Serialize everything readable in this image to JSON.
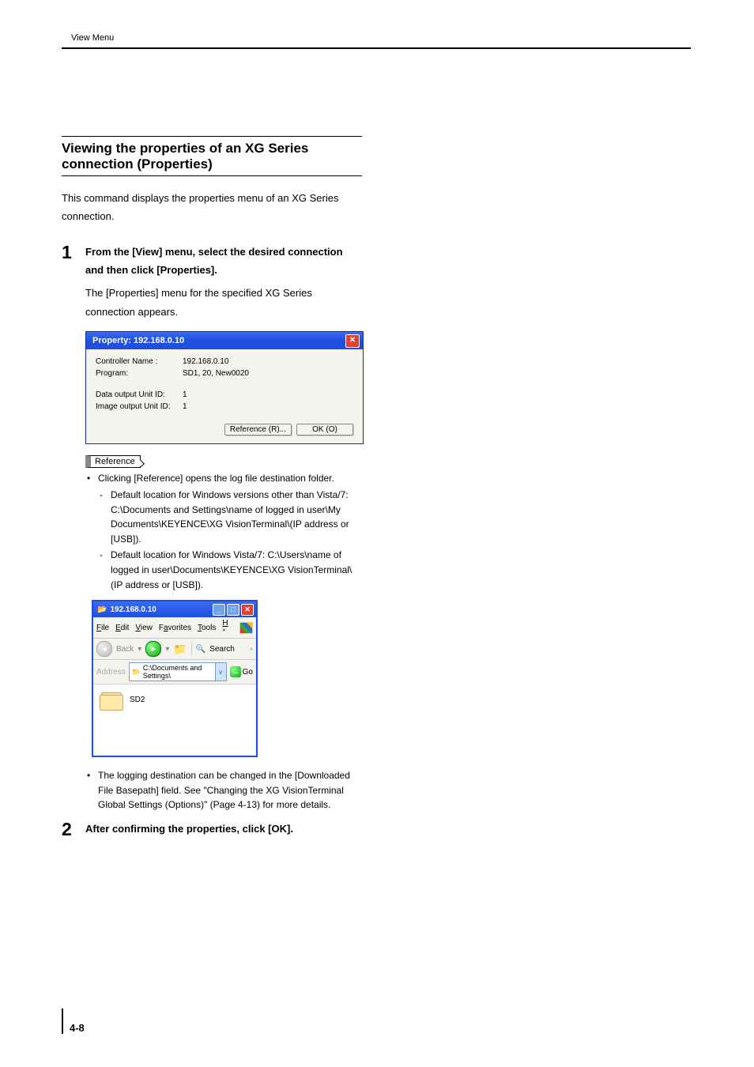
{
  "header": {
    "running_head": "View Menu"
  },
  "section_title": "Viewing the properties of an XG Series connection (Properties)",
  "intro": "This command displays the properties menu of an XG Series connection.",
  "steps": {
    "s1_num": "1",
    "s1_head": "From the [View] menu, select the desired connection and then click [Properties].",
    "s1_body": "The [Properties] menu for the specified XG Series connection appears.",
    "s2_num": "2",
    "s2_head": "After confirming the properties, click [OK]."
  },
  "dialog": {
    "title": "Property: 192.168.0.10",
    "rows": {
      "r1_label": "Controller Name :",
      "r1_value": "192.168.0.10",
      "r2_label": "Program:",
      "r2_value": "SD1, 20, New0020",
      "r3_label": "Data output Unit ID:",
      "r3_value": "1",
      "r4_label": "Image output Unit ID:",
      "r4_value": "1"
    },
    "btn_reference": "Reference (R)...",
    "btn_ok": "OK (O)"
  },
  "reference": {
    "label": "Reference",
    "b1": "Clicking [Reference] opens the log file destination folder.",
    "b1a": "Default location for Windows versions other than Vista/7: C:\\Documents and Settings\\name of logged in user\\My Documents\\KEYENCE\\XG VisionTerminal\\(IP address or [USB]).",
    "b1b": "Default location for Windows Vista/7: C:\\Users\\name of logged in user\\Documents\\KEYENCE\\XG VisionTerminal\\(IP address or [USB]).",
    "b2": "The logging destination can be changed in the [Downloaded File Basepath] field. See \"Changing the XG VisionTerminal Global Settings (Options)\" (Page 4-13) for more details."
  },
  "explorer": {
    "title": "192.168.0.10",
    "menus": {
      "file": "File",
      "edit": "Edit",
      "view": "View",
      "fav": "Favorites",
      "tools": "Tools",
      "help_short": "H"
    },
    "toolbar": {
      "back": "Back",
      "search": "Search"
    },
    "address": {
      "label": "Address",
      "value": "C:\\Documents and Settings\\",
      "go": "Go"
    },
    "item": "SD2"
  },
  "page_number": "4-8"
}
